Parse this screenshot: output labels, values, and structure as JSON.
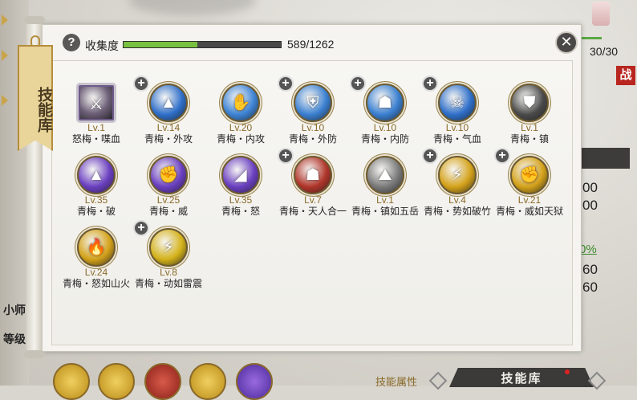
{
  "panel": {
    "tab_label": "技能库",
    "collection_label": "收集度",
    "collection_value": "589/1262",
    "collection_progress": 0.467,
    "close_symbol": "✕",
    "help_symbol": "?"
  },
  "skills": [
    {
      "level": "Lv.1",
      "name": "怒梅・喋血",
      "plus": false,
      "color": "#6d6078",
      "glyph": "⚔",
      "locked": true
    },
    {
      "level": "Lv.14",
      "name": "青梅・外攻",
      "plus": true,
      "color": "#2f6fc9",
      "glyph": "▲"
    },
    {
      "level": "Lv.20",
      "name": "青梅・内攻",
      "plus": false,
      "color": "#3d83d4",
      "glyph": "✋"
    },
    {
      "level": "Lv.10",
      "name": "青梅・外防",
      "plus": true,
      "color": "#3a7fd0",
      "glyph": "⛨"
    },
    {
      "level": "Lv.10",
      "name": "青梅・内防",
      "plus": true,
      "color": "#3a7fd0",
      "glyph": "☗"
    },
    {
      "level": "Lv.10",
      "name": "青梅・气血",
      "plus": true,
      "color": "#2f6fc9",
      "glyph": "☠"
    },
    {
      "level": "Lv.1",
      "name": "青梅・镇",
      "plus": false,
      "color": "#4a4a4a",
      "glyph": "⛊"
    },
    {
      "level": "Lv.35",
      "name": "青梅・破",
      "plus": false,
      "color": "#6a3fc0",
      "glyph": "▲"
    },
    {
      "level": "Lv.25",
      "name": "青梅・威",
      "plus": false,
      "color": "#6a3fc0",
      "glyph": "✊"
    },
    {
      "level": "Lv.35",
      "name": "青梅・怒",
      "plus": false,
      "color": "#6a3fc0",
      "glyph": "◢"
    },
    {
      "level": "Lv.7",
      "name": "青梅・天人合一",
      "plus": true,
      "color": "#b0352a",
      "glyph": "☗"
    },
    {
      "level": "Lv.1",
      "name": "青梅・镇如五岳",
      "plus": false,
      "color": "#7a7a7a",
      "glyph": "⛰"
    },
    {
      "level": "Lv.4",
      "name": "青梅・势如破竹",
      "plus": true,
      "color": "#d4a21a",
      "glyph": "⚡"
    },
    {
      "level": "Lv.21",
      "name": "青梅・威如天狱",
      "plus": true,
      "color": "#d4a21a",
      "glyph": "✊"
    },
    {
      "level": "Lv.24",
      "name": "青梅・怒如山火",
      "plus": false,
      "color": "#d4a21a",
      "glyph": "🔥"
    },
    {
      "level": "Lv.8",
      "name": "青梅・动如雷震",
      "plus": true,
      "color": "#d4b21a",
      "glyph": "⚡"
    }
  ],
  "background": {
    "hp_text": "30/30",
    "battle_badge": "战",
    "right_num_1": "00",
    "right_num_2": "00",
    "right_percent": "0%",
    "right_num_3": "60",
    "right_num_4": "60",
    "left_label_1": "小师",
    "left_label_2": "等级",
    "bottom_tab_attr": "技能属性",
    "bottom_tab_lib": "技能库"
  }
}
